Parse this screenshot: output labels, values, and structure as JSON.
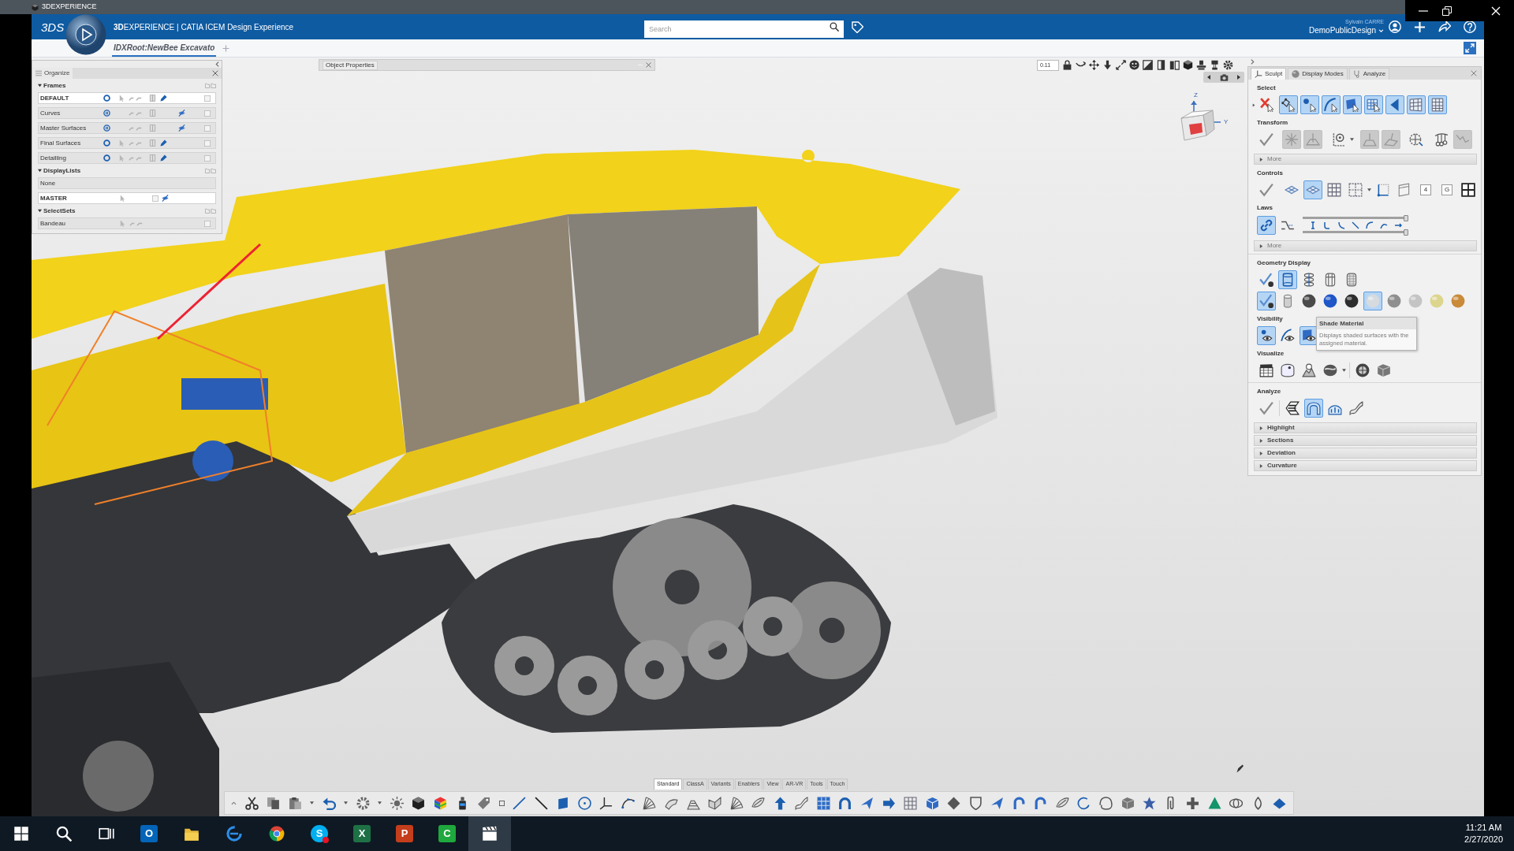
{
  "title_bar": {
    "title": "3DEXPERIENCE"
  },
  "header": {
    "logo": "3DS",
    "title": "**3D**EXPERIENCE | CATIA ICEM Design Experience",
    "search": {
      "placeholder": "Search"
    },
    "user": {
      "name": "Sylvain CARRE",
      "workspace": "DemoPublicDesign"
    }
  },
  "document_tabs": [
    {
      "label": "IDXRoot:NewBee Excavato",
      "selected": true
    }
  ],
  "organize_panel": {
    "title": "Organize",
    "sections": [
      {
        "label": "Frames",
        "expanded": true,
        "rows": [
          {
            "name": "DEFAULT",
            "kind": "frame",
            "current": true,
            "visible": true
          },
          {
            "name": "Curves",
            "kind": "frame",
            "current": false,
            "visible": false
          },
          {
            "name": "Master Surfaces",
            "kind": "frame",
            "current": false,
            "visible": false
          },
          {
            "name": "Final Surfaces",
            "kind": "frame",
            "current": false,
            "visible": true
          },
          {
            "name": "Detailling",
            "kind": "frame",
            "current": false,
            "visible": true
          }
        ]
      },
      {
        "label": "DisplayLists",
        "expanded": true,
        "rows": [
          {
            "name": "None",
            "kind": "empty",
            "current": false
          },
          {
            "name": "MASTER",
            "kind": "list",
            "current": true
          }
        ]
      },
      {
        "label": "SelectSets",
        "expanded": true,
        "rows": [
          {
            "name": "Bandeau",
            "kind": "set",
            "current": false
          }
        ]
      }
    ]
  },
  "object_properties": {
    "title": "Object Properties"
  },
  "view_toolbar": {
    "zoom": "0.11"
  },
  "view_cube": {
    "axes": [
      "Z",
      "Y"
    ]
  },
  "right_panel": {
    "tabs": [
      {
        "label": "Sculpt",
        "selected": true
      },
      {
        "label": "Display Modes",
        "selected": false
      },
      {
        "label": "Analyze",
        "selected": false
      }
    ],
    "blocks": [
      {
        "sections": [
          {
            "kind": "tools",
            "label": "Select",
            "rows": [
              {
                "tools": [
                  {
                    "selected": false
                  },
                  {
                    "selected": true
                  },
                  {
                    "selected": true
                  },
                  {
                    "selected": true
                  },
                  {
                    "selected": true
                  },
                  {
                    "selected": true
                  },
                  {
                    "selected": true
                  },
                  {
                    "selected": true
                  },
                  {
                    "selected": true
                  }
                ]
              }
            ]
          },
          {
            "kind": "tools",
            "label": "Transform",
            "rows": [
              {
                "tools": [
                  {
                    "selected": false,
                    "disabled": false
                  },
                  {
                    "selected": false,
                    "disabled": true
                  },
                  {
                    "selected": false,
                    "disabled": true
                  },
                  {
                    "selected": false,
                    "disabled": false
                  },
                  {
                    "selected": false,
                    "disabled": true
                  },
                  {
                    "selected": false,
                    "disabled": true
                  },
                  {
                    "selected": false,
                    "disabled": false
                  },
                  {
                    "selected": false,
                    "disabled": false
                  },
                  {
                    "selected": false,
                    "disabled": true
                  }
                ]
              }
            ]
          },
          {
            "kind": "more",
            "label": "More",
            "expanded": false
          },
          {
            "kind": "tools",
            "label": "Controls",
            "rows": [
              {
                "tools": [
                  {
                    "selected": false
                  },
                  {
                    "selected": false
                  },
                  {
                    "selected": true
                  },
                  {
                    "selected": false
                  },
                  {
                    "selected": false
                  },
                  {
                    "selected": false
                  },
                  {
                    "selected": false
                  },
                  {
                    "selected": false,
                    "label": "4"
                  },
                  {
                    "selected": false,
                    "label": "G"
                  },
                  {
                    "selected": false
                  }
                ]
              }
            ]
          },
          {
            "kind": "laws",
            "label": "Laws",
            "tools": [
              {
                "selected": true
              },
              {
                "selected": false
              }
            ],
            "sliders": [
              {
                "level": 1
              },
              {
                "level": 1
              }
            ]
          },
          {
            "kind": "more",
            "label": "More",
            "expanded": false
          }
        ]
      },
      {
        "sections": [
          {
            "kind": "tools",
            "label": "Geometry Display",
            "rows": [
              {
                "tools": [
                  {
                    "selected": false
                  },
                  {
                    "selected": true
                  },
                  {
                    "selected": false
                  },
                  {
                    "selected": false
                  },
                  {
                    "selected": false
                  }
                ]
              },
              {
                "tools": [
                  {
                    "selected": true
                  },
                  {
                    "selected": false
                  },
                  {
                    "selected": false
                  },
                  {
                    "selected": false
                  },
                  {
                    "selected": false
                  },
                  {
                    "selected": true
                  },
                  {
                    "selected": false
                  },
                  {
                    "selected": false
                  },
                  {
                    "selected": false
                  },
                  {
                    "selected": false
                  }
                ]
              }
            ]
          },
          {
            "kind": "tools",
            "label": "Visibility",
            "rows": [
              {
                "tools": [
                  {
                    "selected": true
                  },
                  {
                    "selected": false
                  },
                  {
                    "selected": true
                  }
                ]
              }
            ]
          },
          {
            "kind": "tools",
            "label": "Visualize",
            "rows": [
              {
                "tools": [
                  {
                    "selected": false
                  },
                  {
                    "selected": false
                  },
                  {
                    "selected": false
                  },
                  {
                    "selected": false
                  },
                  {
                    "selected": false
                  },
                  {
                    "selected": false
                  }
                ]
              }
            ]
          }
        ]
      },
      {
        "sections": [
          {
            "kind": "tools",
            "label": "Analyze",
            "rows": [
              {
                "tools": [
                  {
                    "selected": false
                  },
                  {
                    "selected": false
                  },
                  {
                    "selected": true
                  },
                  {
                    "selected": false
                  },
                  {
                    "selected": false
                  }
                ]
              }
            ]
          },
          {
            "kind": "fold",
            "label": "Highlight",
            "expanded": false
          },
          {
            "kind": "fold",
            "label": "Sections",
            "expanded": false
          },
          {
            "kind": "fold",
            "label": "Deviation",
            "expanded": false
          },
          {
            "kind": "fold",
            "label": "Curvature",
            "expanded": false
          }
        ]
      }
    ],
    "tooltip": {
      "title": "Shade Material",
      "text": "Displays shaded surfaces with the assigned material."
    }
  },
  "bottom_toolbar": {
    "tabs": [
      {
        "label": "Standard",
        "selected": true
      },
      {
        "label": "ClassA",
        "selected": false
      },
      {
        "label": "Variants",
        "selected": false
      },
      {
        "label": "Enablers",
        "selected": false
      },
      {
        "label": "View",
        "selected": false
      },
      {
        "label": "AR-VR",
        "selected": false
      },
      {
        "label": "Tools",
        "selected": false
      },
      {
        "label": "Touch",
        "selected": false
      }
    ]
  },
  "taskbar": {
    "apps": [
      {
        "kind": "start",
        "selected": false,
        "alert": false
      },
      {
        "kind": "search",
        "selected": false,
        "alert": false
      },
      {
        "kind": "tasks",
        "selected": false,
        "alert": false
      },
      {
        "kind": "mail",
        "glyph": "O",
        "selected": false,
        "alert": false
      },
      {
        "kind": "folder",
        "selected": false,
        "alert": false
      },
      {
        "kind": "browser",
        "selected": false,
        "alert": false
      },
      {
        "kind": "wheel",
        "selected": false,
        "alert": false
      },
      {
        "kind": "chat",
        "glyph": "S",
        "selected": false,
        "alert": true
      },
      {
        "kind": "sheet",
        "glyph": "X",
        "selected": false,
        "alert": false
      },
      {
        "kind": "slides",
        "glyph": "P",
        "selected": false,
        "alert": false
      },
      {
        "kind": "recorder",
        "glyph": "C",
        "selected": false,
        "alert": false
      },
      {
        "kind": "clapper",
        "selected": true,
        "alert": false
      }
    ],
    "clock": {
      "time": "11:21 AM",
      "date": "2/27/2020"
    }
  }
}
